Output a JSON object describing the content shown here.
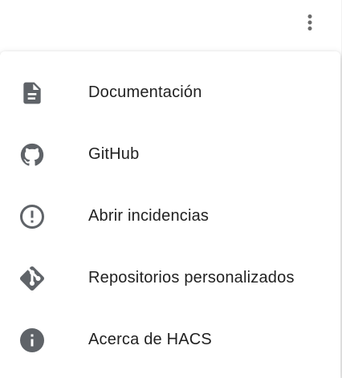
{
  "header": {
    "overflow_icon": "dots-vertical-icon"
  },
  "menu": {
    "items": [
      {
        "label": "Documentación",
        "icon": "file-document-icon"
      },
      {
        "label": "GitHub",
        "icon": "github-icon"
      },
      {
        "label": "Abrir incidencias",
        "icon": "alert-circle-outline-icon"
      },
      {
        "label": "Repositorios personalizados",
        "icon": "git-icon"
      },
      {
        "label": "Acerca de HACS",
        "icon": "information-icon"
      }
    ]
  },
  "colors": {
    "icon": "#5f6368",
    "text": "#212121",
    "background": "#ffffff"
  }
}
